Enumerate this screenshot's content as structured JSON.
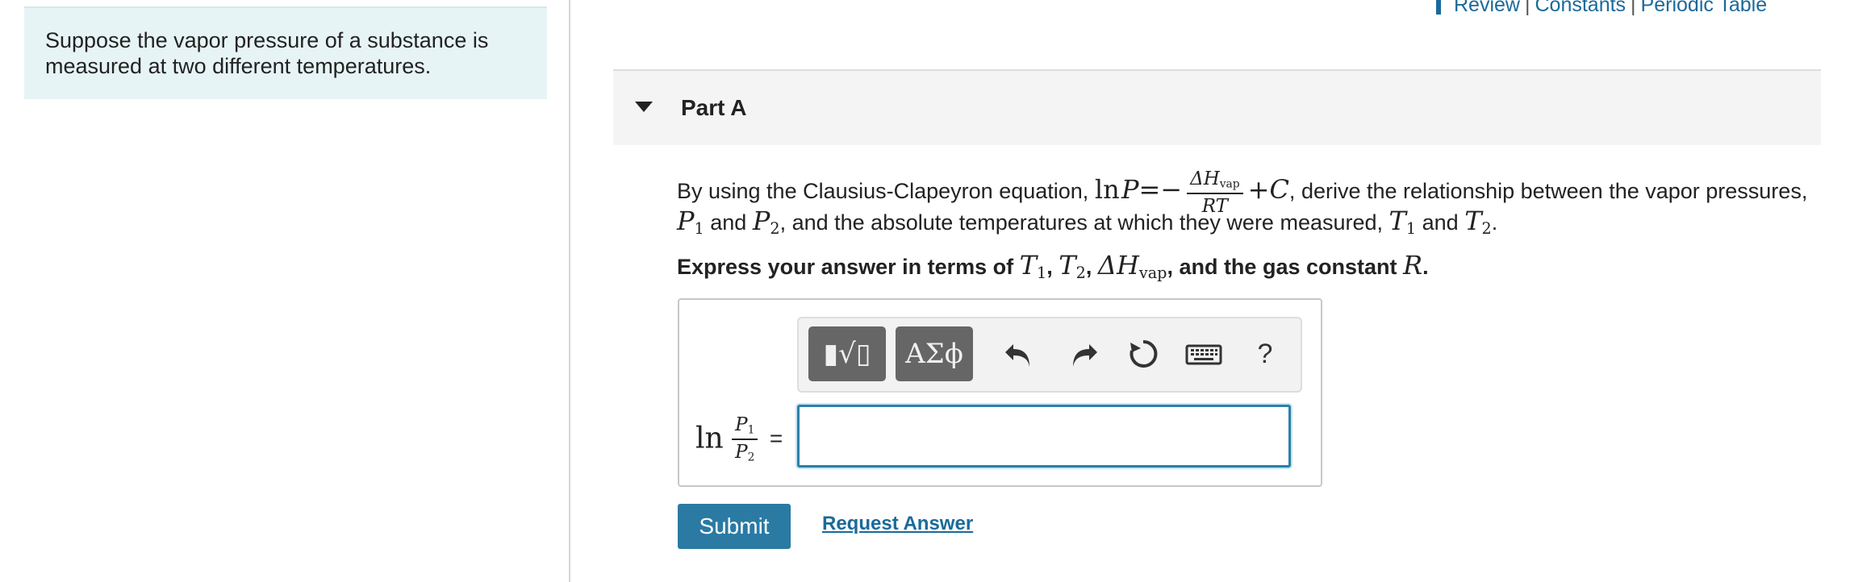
{
  "intro": {
    "text": "Suppose the vapor pressure of a substance is measured at two different temperatures."
  },
  "top_links": {
    "review": "Review",
    "constants": "Constants",
    "periodic_table": "Periodic Table",
    "separator": "|"
  },
  "part": {
    "title": "Part A"
  },
  "question": {
    "line1_prefix": "By using the Clausius-Clapeyron equation,",
    "line1_suffix": "derive the relationship between the vapor pressures,",
    "line2_and1": "and",
    "line2_middle": ", and the absolute temperatures at which they were measured,",
    "line2_and2": "and",
    "line3_prefix": "Express your answer in terms of",
    "line3_suffix": ", and the gas constant"
  },
  "equation": {
    "ln": "ln",
    "P": "P",
    "eq_minus": "=−",
    "dH": "ΔH",
    "vap": "vap",
    "RT": "RT",
    "plusC": "+C",
    "comma": ","
  },
  "symbols": {
    "P": "P",
    "T": "T",
    "one": "1",
    "two": "2",
    "dH": "ΔH",
    "vap": "vap",
    "R": "R",
    "period": ".",
    "comma": ","
  },
  "toolbar": {
    "templates_label": "▮√▯",
    "greek_label": "ΑΣϕ",
    "help_label": "?"
  },
  "answer": {
    "lhs_ln": "ln",
    "lhs_num": "P",
    "lhs_den": "P",
    "equals": "=",
    "input_value": ""
  },
  "actions": {
    "submit": "Submit",
    "request_answer": "Request Answer"
  },
  "colors": {
    "accent": "#2a7aa3",
    "link": "#1a6a9a",
    "intro_bg": "#e7f4f6",
    "part_bg": "#f4f4f4"
  }
}
